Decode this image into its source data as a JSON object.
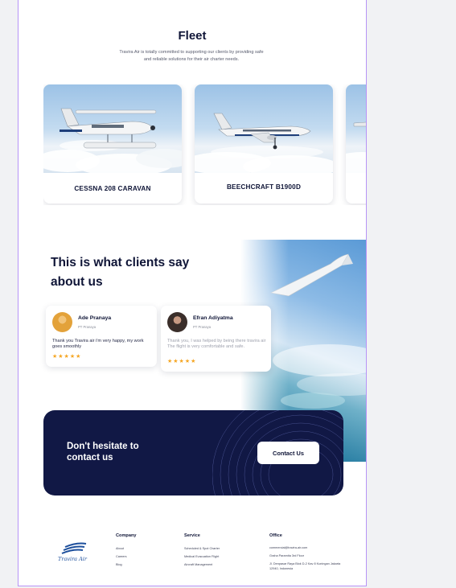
{
  "fleet": {
    "title": "Fleet",
    "subtitle": "Travira Air is totally committed to supporting our clients by providing safe and reliable solutions for their air charter needs.",
    "cards": [
      {
        "name": "CESSNA 208 CARAVAN"
      },
      {
        "name": "BEECHCRAFT B1900D"
      },
      {
        "name": ""
      }
    ]
  },
  "testimonials": {
    "title": "This is what clients say about us",
    "items": [
      {
        "name": "Ade Pranaya",
        "company": "PT Pranaya",
        "quote": "Thank you Travira air i'm very happy, my work goes smoothly",
        "rating": "★★★★★"
      },
      {
        "name": "Efran Adiyatma",
        "company": "PT Pranaya",
        "quote": "Thank you, I was helped by being there travira air The flight is very comfortable and safe.",
        "rating": "★★★★★"
      }
    ]
  },
  "cta": {
    "text": "Don't hesitate to contact us",
    "button": "Contact Us"
  },
  "footer": {
    "logo_text": "Travira Air",
    "company": {
      "heading": "Company",
      "links": [
        "About",
        "Careers",
        "Blog"
      ]
    },
    "service": {
      "heading": "Service",
      "links": [
        "Scheduled & Spot Charter",
        "Medical Evacuation Flight",
        "Aircraft Management"
      ]
    },
    "office": {
      "heading": "Office",
      "email": "commercial@travira-air.com",
      "building": "Graha Paramita 3rd Floor",
      "address": "Jl. Denpasar Raya Blok D-2 Kav 8 Kuningan Jakarta 12940, Indonesia"
    }
  },
  "colors": {
    "navy": "#111845",
    "star": "#f5a623",
    "frame": "#b794f6"
  }
}
